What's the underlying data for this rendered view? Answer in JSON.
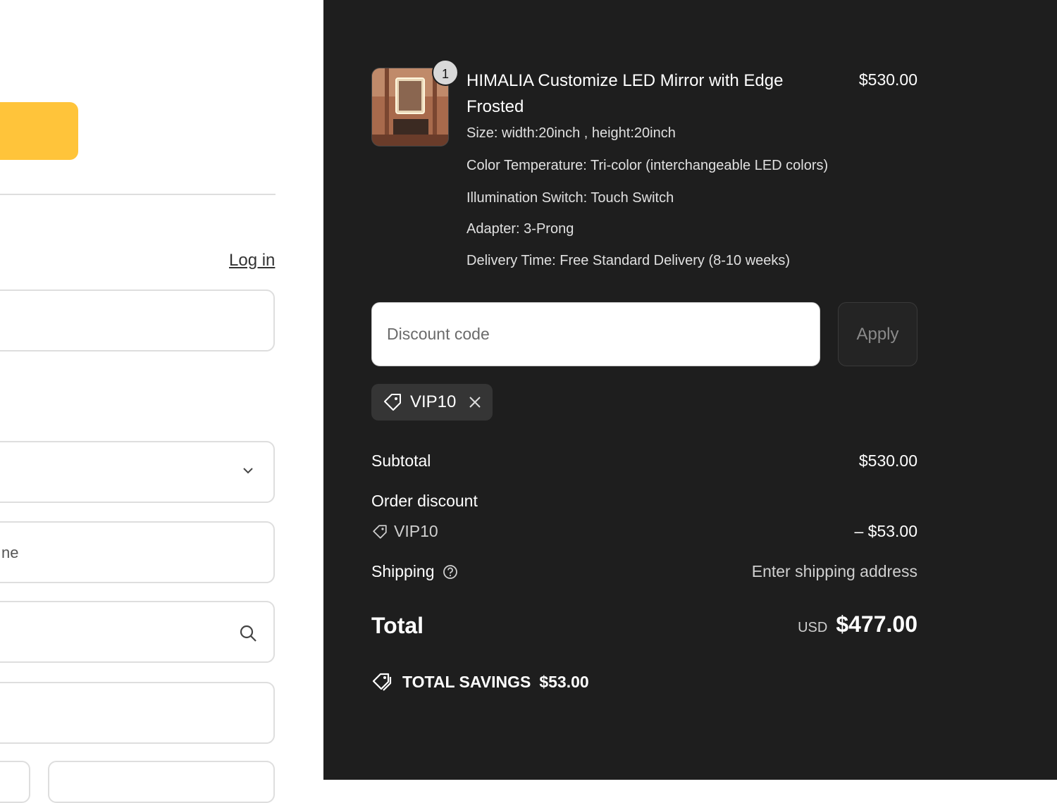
{
  "left": {
    "login_link": "Log in",
    "field_partial_text": "ne"
  },
  "product": {
    "quantity": "1",
    "title": "HIMALIA Customize LED Mirror with Edge Frosted",
    "price": "$530.00",
    "options": [
      "Size: width:20inch , height:20inch",
      "Color Temperature: Tri-color (interchangeable LED colors)",
      "Illumination Switch: Touch Switch",
      "Adapter: 3-Prong",
      "Delivery Time: Free Standard Delivery (8-10 weeks)"
    ]
  },
  "discount": {
    "placeholder": "Discount code",
    "apply_label": "Apply",
    "applied_code": "VIP10"
  },
  "summary": {
    "subtotal_label": "Subtotal",
    "subtotal_value": "$530.00",
    "order_discount_label": "Order discount",
    "discount_code": "VIP10",
    "discount_value": "– $53.00",
    "shipping_label": "Shipping",
    "shipping_value": "Enter shipping address",
    "total_label": "Total",
    "currency": "USD",
    "total_value": "$477.00",
    "savings_label": "TOTAL SAVINGS",
    "savings_value": "$53.00"
  },
  "colors": {
    "accent_button": "#ffc43a",
    "panel_bg": "#1e1e1e"
  }
}
